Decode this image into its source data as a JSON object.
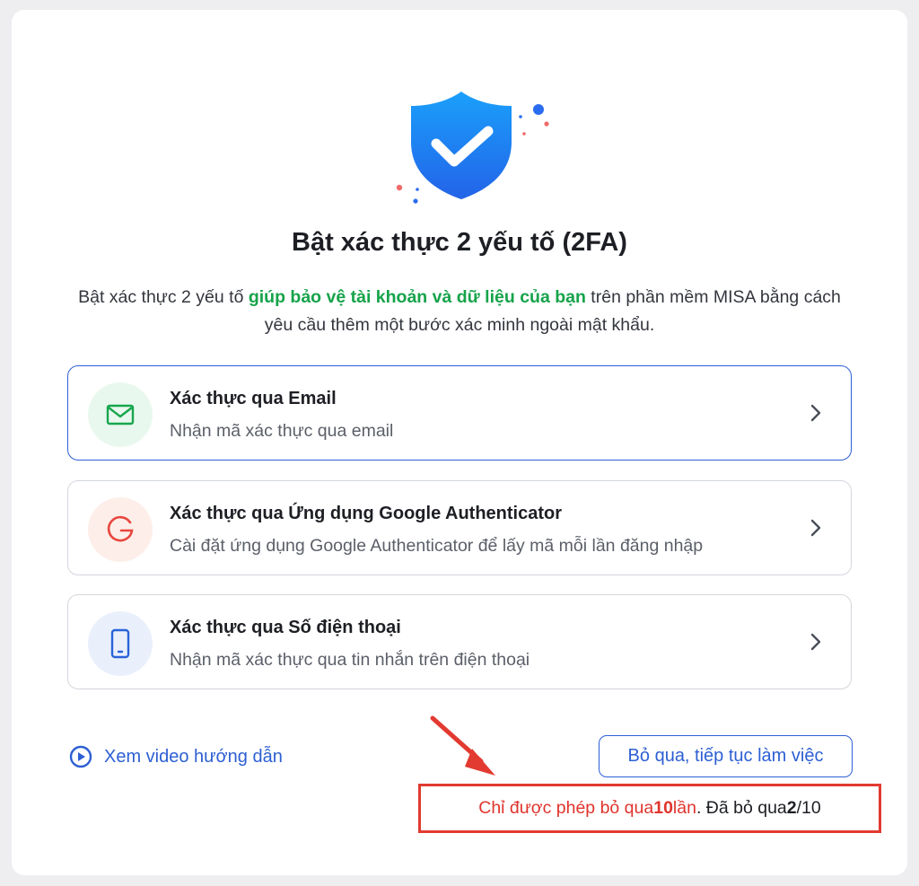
{
  "title": "Bật xác thực 2 yếu tố (2FA)",
  "description": {
    "part1": "Bật xác thực 2 yếu tố ",
    "highlight": "giúp bảo vệ tài khoản và dữ liệu của bạn",
    "part2": " trên phần mềm MISA bằng cách yêu cầu thêm một bước xác minh ngoài mật khẩu."
  },
  "options": [
    {
      "title": "Xác thực qua Email",
      "subtitle": "Nhận mã xác thực qua email",
      "icon": "mail-icon",
      "active": true
    },
    {
      "title": "Xác thực qua Ứng dụng Google Authenticator",
      "subtitle": "Cài đặt ứng dụng Google Authenticator để lấy mã mỗi lần đăng nhập",
      "icon": "google-icon",
      "active": false
    },
    {
      "title": "Xác thực qua Số điện thoại",
      "subtitle": "Nhận mã xác thực qua tin nhắn trên điện thoại",
      "icon": "phone-icon",
      "active": false
    }
  ],
  "video_link": {
    "label": "Xem video hướng dẫn",
    "icon": "play-circle-icon"
  },
  "skip_button": {
    "label": "Bỏ qua, tiếp tục làm việc"
  },
  "skip_note": {
    "prefix": "Chỉ được phép bỏ qua ",
    "max": "10",
    "unit": " lần",
    "sep": ". Đã bỏ qua ",
    "used": "2",
    "total": "/10"
  },
  "colors": {
    "primary": "#2f5fd6",
    "highlight_green": "#16a34a",
    "warning_red": "#e0342c",
    "shield_blue": "#1f7ef0"
  }
}
